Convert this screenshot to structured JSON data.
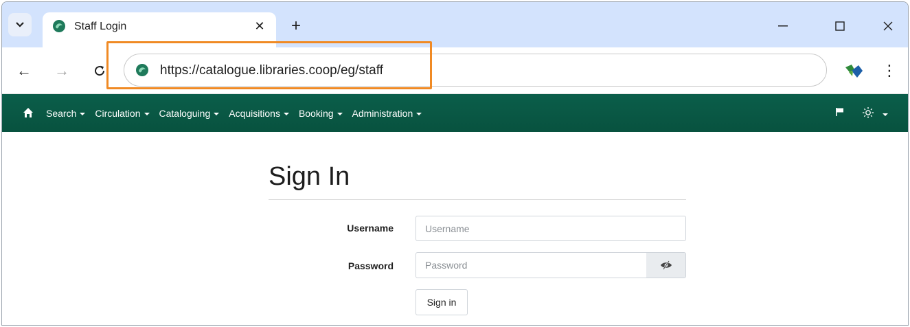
{
  "browser": {
    "tab": {
      "title": "Staff Login",
      "close_glyph": "✕"
    },
    "new_tab_glyph": "+",
    "window_controls": {
      "minimize": "—",
      "maximize": "☐",
      "close": "✕"
    },
    "nav": {
      "back": "←",
      "forward": "→",
      "reload": "C"
    },
    "address": {
      "url": "https://catalogue.libraries.coop/eg/staff"
    },
    "menu_glyph": "⋮",
    "accent_highlight_color": "#f08a24"
  },
  "appnav": {
    "color": "#0b5e4a",
    "items": [
      {
        "label": "Search"
      },
      {
        "label": "Circulation"
      },
      {
        "label": "Cataloguing"
      },
      {
        "label": "Acquisitions"
      },
      {
        "label": "Booking"
      },
      {
        "label": "Administration"
      }
    ],
    "icons": [
      "home-icon",
      "flag-icon",
      "theme-sun-icon"
    ]
  },
  "login": {
    "heading": "Sign In",
    "username": {
      "label": "Username",
      "placeholder": "Username",
      "value": ""
    },
    "password": {
      "label": "Password",
      "placeholder": "Password",
      "value": ""
    },
    "submit_label": "Sign in"
  }
}
